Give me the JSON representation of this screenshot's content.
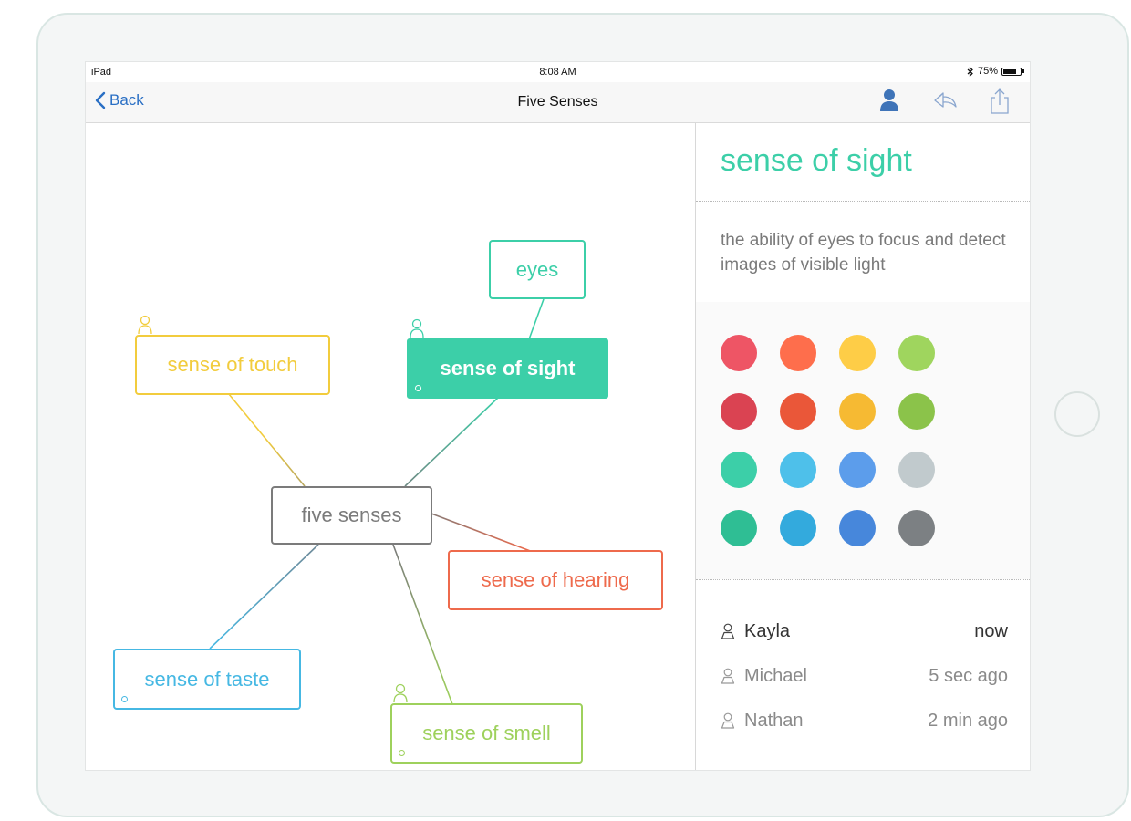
{
  "status_bar": {
    "device": "iPad",
    "time": "8:08 AM",
    "battery": "75%",
    "battery_level": 0.75
  },
  "nav": {
    "back_label": "Back",
    "title": "Five Senses",
    "icons": [
      "person-icon",
      "reply-icon",
      "share-icon"
    ]
  },
  "mindmap": {
    "central": "five senses",
    "topics": {
      "touch": "sense of touch",
      "sight": "sense of sight",
      "eyes": "eyes",
      "hearing": "sense of hearing",
      "taste": "sense of taste",
      "smell": "sense of smell"
    },
    "colors": {
      "touch": "#f2cc3d",
      "sight": "#3ccfa8",
      "hearing": "#ee6a4c",
      "taste": "#46b8e3",
      "smell": "#9ed15c",
      "central": "#7b7b7b"
    }
  },
  "sidebar": {
    "title": "sense of sight",
    "description": "the ability of eyes to focus and detect images of visible light",
    "palette": [
      [
        "#ee5565",
        "#fe6e4c",
        "#fecd47",
        "#9fd55e"
      ],
      [
        "#da4352",
        "#ea5739",
        "#f6ba33",
        "#8bc34a"
      ],
      [
        "#3ccfa8",
        "#4ec0ea",
        "#5c9deb",
        "#c1cacd"
      ],
      [
        "#2fbe94",
        "#33aadd",
        "#4787db",
        "#7c8083"
      ]
    ],
    "collaborators": [
      {
        "name": "Kayla",
        "time": "now"
      },
      {
        "name": "Michael",
        "time": "5 sec ago"
      },
      {
        "name": "Nathan",
        "time": "2 min ago"
      }
    ]
  }
}
